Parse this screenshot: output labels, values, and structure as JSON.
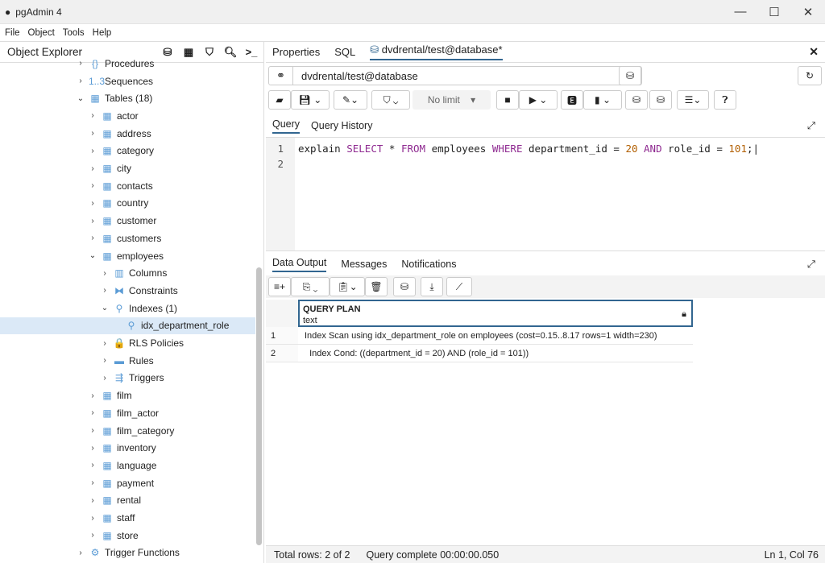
{
  "window": {
    "title": "pgAdmin 4",
    "controls": [
      "—",
      "☐",
      "✕"
    ]
  },
  "menu": [
    "File",
    "Object",
    "Tools",
    "Help"
  ],
  "object_explorer": {
    "title": "Object Explorer",
    "tree": [
      {
        "label": "Procedures",
        "level": 0,
        "chev": "›",
        "icon": "{}"
      },
      {
        "label": "Sequences",
        "level": 0,
        "chev": "›",
        "icon": "1..3"
      },
      {
        "label": "Tables (18)",
        "level": 0,
        "chev": "⌄",
        "icon": "▦"
      },
      {
        "label": "actor",
        "level": 1,
        "chev": "›",
        "icon": "▦"
      },
      {
        "label": "address",
        "level": 1,
        "chev": "›",
        "icon": "▦"
      },
      {
        "label": "category",
        "level": 1,
        "chev": "›",
        "icon": "▦"
      },
      {
        "label": "city",
        "level": 1,
        "chev": "›",
        "icon": "▦"
      },
      {
        "label": "contacts",
        "level": 1,
        "chev": "›",
        "icon": "▦"
      },
      {
        "label": "country",
        "level": 1,
        "chev": "›",
        "icon": "▦"
      },
      {
        "label": "customer",
        "level": 1,
        "chev": "›",
        "icon": "▦"
      },
      {
        "label": "customers",
        "level": 1,
        "chev": "›",
        "icon": "▦"
      },
      {
        "label": "employees",
        "level": 1,
        "chev": "⌄",
        "icon": "▦"
      },
      {
        "label": "Columns",
        "level": 2,
        "chev": "›",
        "icon": "▥"
      },
      {
        "label": "Constraints",
        "level": 2,
        "chev": "›",
        "icon": "⧓"
      },
      {
        "label": "Indexes (1)",
        "level": 2,
        "chev": "⌄",
        "icon": "⚲"
      },
      {
        "label": "idx_department_role",
        "level": 3,
        "chev": "",
        "icon": "⚲",
        "selected": true
      },
      {
        "label": "RLS Policies",
        "level": 2,
        "chev": "›",
        "icon": "🔒"
      },
      {
        "label": "Rules",
        "level": 2,
        "chev": "›",
        "icon": "▬"
      },
      {
        "label": "Triggers",
        "level": 2,
        "chev": "›",
        "icon": "⇶"
      },
      {
        "label": "film",
        "level": 1,
        "chev": "›",
        "icon": "▦"
      },
      {
        "label": "film_actor",
        "level": 1,
        "chev": "›",
        "icon": "▦"
      },
      {
        "label": "film_category",
        "level": 1,
        "chev": "›",
        "icon": "▦"
      },
      {
        "label": "inventory",
        "level": 1,
        "chev": "›",
        "icon": "▦"
      },
      {
        "label": "language",
        "level": 1,
        "chev": "›",
        "icon": "▦"
      },
      {
        "label": "payment",
        "level": 1,
        "chev": "›",
        "icon": "▦"
      },
      {
        "label": "rental",
        "level": 1,
        "chev": "›",
        "icon": "▦"
      },
      {
        "label": "staff",
        "level": 1,
        "chev": "›",
        "icon": "▦"
      },
      {
        "label": "store",
        "level": 1,
        "chev": "›",
        "icon": "▦"
      },
      {
        "label": "Trigger Functions",
        "level": 0,
        "chev": "›",
        "icon": "⚙"
      }
    ]
  },
  "tabs": [
    {
      "label": "Properties"
    },
    {
      "label": "SQL"
    },
    {
      "label": "dvdrental/test@database*",
      "active": true
    }
  ],
  "connection": "dvdrental/test@database",
  "toolbar": {
    "limit": "No limit"
  },
  "query_tabs": [
    "Query",
    "Query History"
  ],
  "editor": {
    "line_numbers": [
      "1",
      "2"
    ]
  },
  "output_tabs": [
    "Data Output",
    "Messages",
    "Notifications"
  ],
  "grid": {
    "column": "QUERY PLAN",
    "type": "text",
    "rows": [
      {
        "n": "1",
        "v": "Index Scan using idx_department_role on employees  (cost=0.15..8.17 rows=1 width=230)"
      },
      {
        "n": "2",
        "v": "  Index Cond: ((department_id = 20) AND (role_id = 101))"
      }
    ]
  },
  "status": {
    "rows": "Total rows: 2 of 2",
    "time": "Query complete 00:00:00.050",
    "pos": "Ln 1, Col 76"
  },
  "colors": {
    "accent": "#326690",
    "keyword": "#8f2b91",
    "number": "#b25f00"
  }
}
